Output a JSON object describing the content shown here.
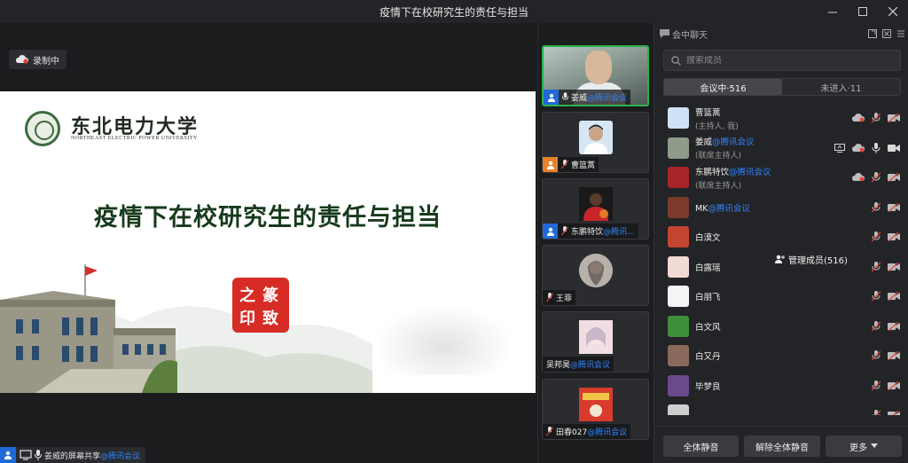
{
  "window": {
    "title": "疫情下在校研究生的责任与担当",
    "controls": [
      "minimize",
      "maximize",
      "close"
    ]
  },
  "stage": {
    "recording_label": "录制中",
    "slide": {
      "university_cn": "东北电力大学",
      "university_en": "NORTHEAST ELECTRIC POWER UNIVERSITY",
      "title": "疫情下在校研究生的责任与担当",
      "seal_chars": [
        "之",
        "篆",
        "印",
        "致"
      ]
    },
    "share_bar": {
      "text": "姜威的屏幕共享",
      "tag": "@腾讯会议"
    }
  },
  "video_strip": [
    {
      "name": "姜威",
      "tag": "@腾讯会议",
      "host": "blue",
      "camera": true,
      "active": true
    },
    {
      "name": "曹篮蒿",
      "tag": "",
      "host": "orange",
      "camera": false,
      "avatar_color": "#d7e6f5"
    },
    {
      "name": "东鹏特饮",
      "tag": "@腾讯...",
      "host": "blue",
      "camera": false,
      "avatar_color": "#b0282a"
    },
    {
      "name": "王菲",
      "tag": "",
      "host": "",
      "camera": false,
      "avatar_color": "#9e9a94"
    },
    {
      "name": "吴邦昊",
      "tag": "@腾讯会议",
      "host": "",
      "camera": false,
      "avatar_color": "#e8c9cf"
    },
    {
      "name": "田春027",
      "tag": "@腾讯会议",
      "host": "",
      "camera": false,
      "avatar_color": "#d63a2c"
    }
  ],
  "panel": {
    "tab_chat": "会中聊天",
    "tab_members": "管理成员(516)",
    "search_placeholder": "搜索成员",
    "seg_in": "会议中·516",
    "seg_out": "未进入·11",
    "members": [
      {
        "name": "曹篮蒿",
        "tag": "",
        "sub": "(主持人, 我)",
        "avatar_color": "#cfe1f4",
        "icons": [
          "cloud-rec",
          "mic-off",
          "cam-off"
        ]
      },
      {
        "name": "姜威",
        "tag": "@腾讯会议",
        "sub": "(联席主持人)",
        "avatar_color": "#8f9b8a",
        "icons": [
          "screen",
          "cloud-rec",
          "mic",
          "cam"
        ]
      },
      {
        "name": "东鹏特饮",
        "tag": "@腾讯会议",
        "sub": "(联席主持人)",
        "avatar_color": "#a72427",
        "icons": [
          "cloud-rec",
          "mic-off",
          "cam-off"
        ]
      },
      {
        "name": "MK",
        "tag": "@腾讯会议",
        "sub": "",
        "avatar_color": "#7a3b2a",
        "icons": [
          "mic-off",
          "cam-off"
        ]
      },
      {
        "name": "白漠文",
        "tag": "",
        "sub": "",
        "avatar_color": "#c4452f",
        "icons": [
          "mic-off",
          "cam-off"
        ]
      },
      {
        "name": "白露瑶",
        "tag": "",
        "sub": "",
        "avatar_color": "#f1d9d4",
        "icons": [
          "mic-off",
          "cam-off"
        ]
      },
      {
        "name": "白朋飞",
        "tag": "",
        "sub": "",
        "avatar_color": "#f4f4f4",
        "icons": [
          "mic-off",
          "cam-off"
        ]
      },
      {
        "name": "白文风",
        "tag": "",
        "sub": "",
        "avatar_color": "#3f8f3a",
        "icons": [
          "mic-off",
          "cam-off"
        ]
      },
      {
        "name": "白又丹",
        "tag": "",
        "sub": "",
        "avatar_color": "#8a6a5c",
        "icons": [
          "mic-off",
          "cam-off"
        ]
      },
      {
        "name": "毕梦良",
        "tag": "",
        "sub": "",
        "avatar_color": "#6a4a8c",
        "icons": [
          "mic-off",
          "cam-off"
        ]
      },
      {
        "name": "",
        "tag": "",
        "sub": "",
        "avatar_color": "#cfcfcf",
        "icons": [
          "mic-off",
          "cam-off"
        ]
      }
    ],
    "btn_mute_all": "全体静音",
    "btn_unmute_all": "解除全体静音",
    "btn_more": "更多"
  },
  "colors": {
    "accent_blue": "#2f84ff",
    "host_blue": "#1f6ad6",
    "host_orange": "#e8812a",
    "active_green": "#2bb34a",
    "muted_red": "#e0463a"
  }
}
